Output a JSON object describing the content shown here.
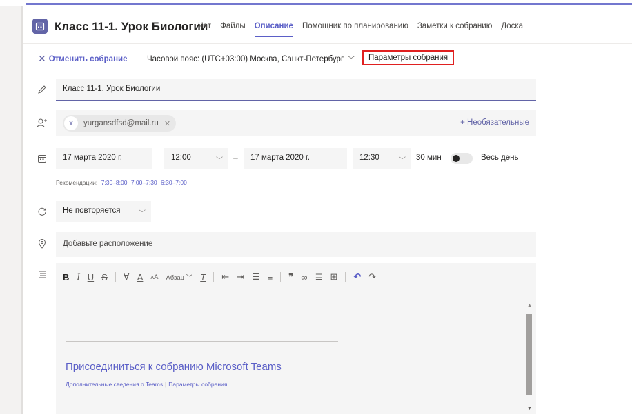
{
  "header": {
    "title": "Класс 11-1. Урок Биологии",
    "tabs": [
      {
        "label": "Чат"
      },
      {
        "label": "Файлы"
      },
      {
        "label": "Описание"
      },
      {
        "label": "Помощник по планированию"
      },
      {
        "label": "Заметки к собранию"
      },
      {
        "label": "Доска"
      }
    ],
    "active_tab": "Описание"
  },
  "toolbar": {
    "cancel_label": "Отменить собрание",
    "timezone_label": "Часовой пояс: (UTC+03:00) Москва, Санкт-Петербург",
    "params_label": "Параметры собрания"
  },
  "form": {
    "title_value": "Класс 11-1. Урок Биологии",
    "attendee": {
      "initial": "Y",
      "email": "yurgansdfsd@mail.ru"
    },
    "optional_label": "+ Необязательные",
    "start_date": "17 марта 2020 г.",
    "start_time": "12:00",
    "end_date": "17 марта 2020 г.",
    "end_time": "12:30",
    "duration": "30 мин",
    "all_day_label": "Весь день",
    "all_day_on": false,
    "recommendations_label": "Рекомендации:",
    "recommendations": [
      "7:30–8:00",
      "7:00–7:30",
      "6:30–7:00"
    ],
    "repeat_value": "Не повторяется",
    "location_placeholder": "Добавьте расположение"
  },
  "editor": {
    "paragraph_label": "Абзац",
    "join_link": "Присоединиться к собранию Microsoft Teams",
    "more_info_link": "Дополнительные сведения о Teams",
    "separator": "|",
    "params_link": "Параметры собрания"
  },
  "colors": {
    "accent": "#5b5fc7",
    "highlight_border": "#e02020",
    "field_bg": "#f5f5f5"
  }
}
